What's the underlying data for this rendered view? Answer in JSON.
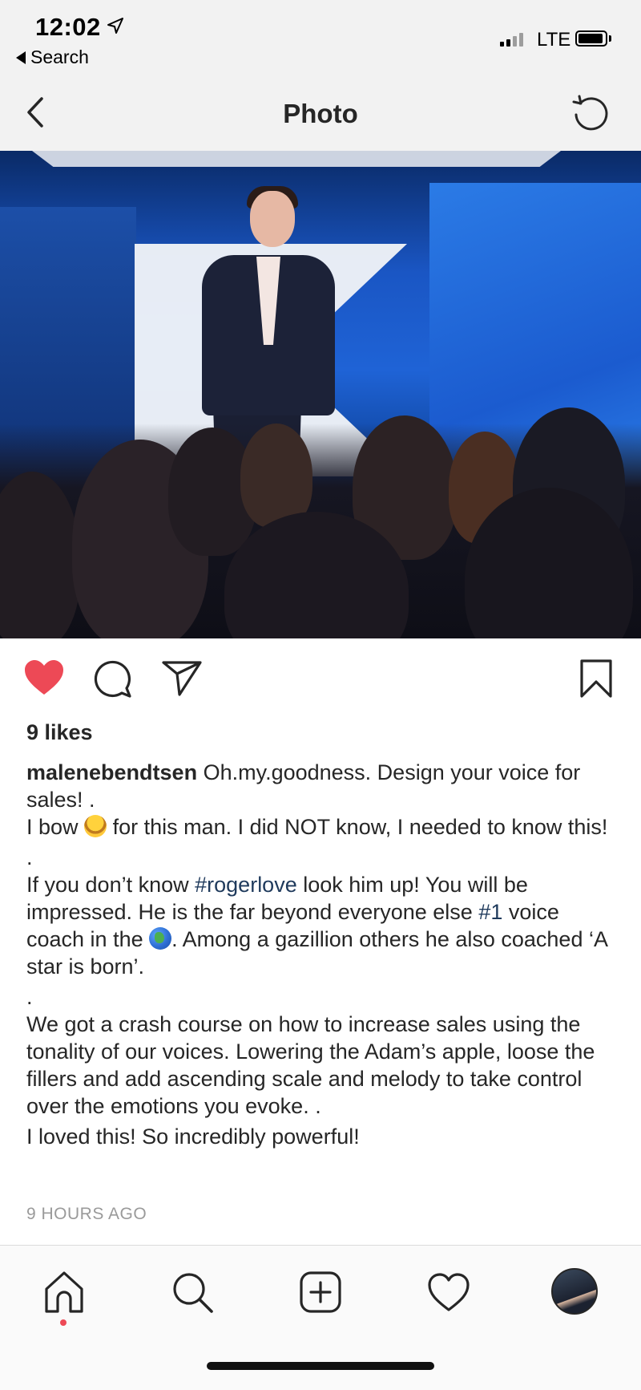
{
  "status_bar": {
    "time": "12:02",
    "back_app": "Search",
    "network": "LTE"
  },
  "nav": {
    "title": "Photo",
    "back_icon": "chevron-left-icon",
    "refresh_icon": "refresh-icon"
  },
  "post": {
    "liked": true,
    "likes": "9 likes",
    "username": "malenebendtsen",
    "caption_1": "Oh.my.goodness. Design your voice for sales! .",
    "caption_2a": "I bow",
    "caption_2b": "for this man. I did NOT know, I needed to know this!",
    "dot": ".",
    "caption_3a": "If you don’t know",
    "tag_1": "#rogerlove",
    "caption_3b": "look him up! You will be impressed. He is the far beyond everyone else",
    "tag_2": "#1",
    "caption_3c": "voice coach in the",
    "caption_3d": ". Among a gazillion others he also coached ‘A star is born’.",
    "caption_4": "We got a crash course on how to increase sales using the tonality of our voices. Lowering the Adam’s apple, loose the fillers and add ascending scale and melody to take control over the emotions you evoke. .",
    "caption_5": "I loved this! So incredibly powerful!",
    "timestamp": "9 HOURS AGO"
  },
  "colors": {
    "like_red": "#ed4956",
    "hashtag": "#1f3a5c",
    "bar_bg": "#f2f2f2"
  },
  "tabbar": {
    "items": [
      "home-icon",
      "search-icon",
      "add-post-icon",
      "activity-heart-icon",
      "profile-avatar"
    ],
    "active": "home-icon"
  }
}
